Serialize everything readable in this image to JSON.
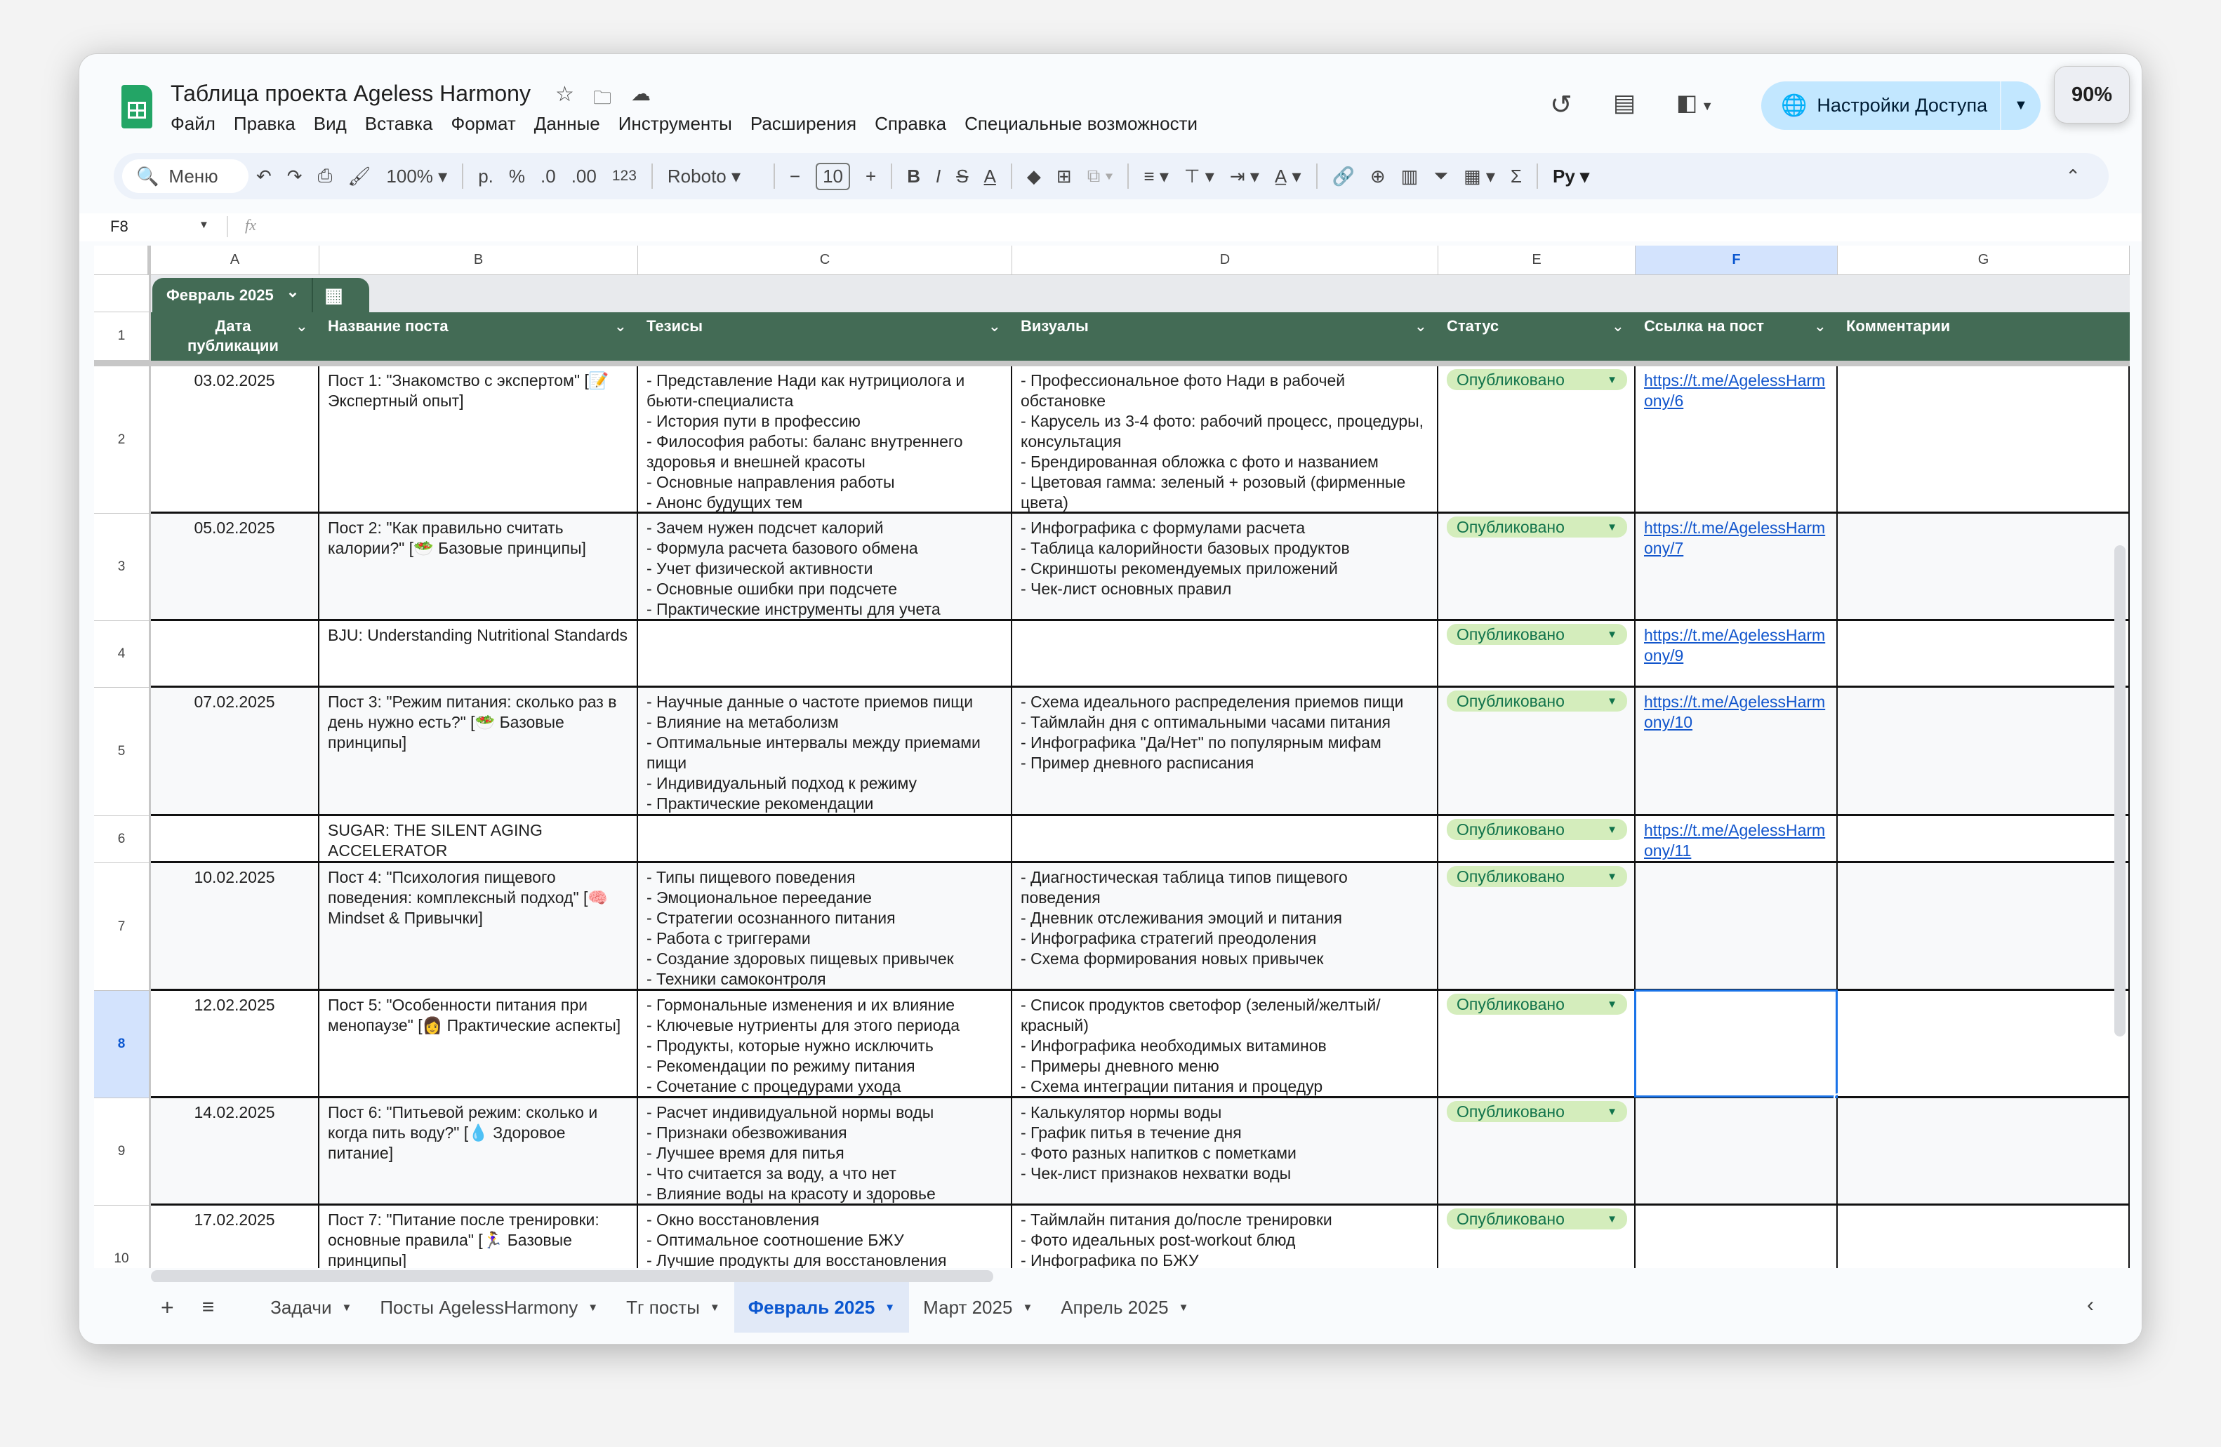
{
  "app": {
    "title": "Таблица проекта Ageless Harmony",
    "zoom": "90%",
    "share_label": "Настройки Доступа"
  },
  "menu": [
    "Файл",
    "Правка",
    "Вид",
    "Вставка",
    "Формат",
    "Данные",
    "Инструменты",
    "Расширения",
    "Справка",
    "Специальные возможности"
  ],
  "toolbar": {
    "search": "Меню",
    "zoom": "100%",
    "currency": "р.",
    "percent": "%",
    "dec_less": ".0",
    "dec_more": ".00",
    "number_format": "123",
    "font": "Roboto",
    "font_size": "10",
    "bold": "B",
    "italic": "I",
    "strike": "S",
    "text_color": "A",
    "python": "Pу"
  },
  "formula": {
    "cell_ref": "F8",
    "fx": "fx",
    "value": ""
  },
  "columns": [
    "A",
    "B",
    "C",
    "D",
    "E",
    "F",
    "G"
  ],
  "table": {
    "name": "Февраль 2025",
    "headers": [
      "Дата публикации",
      "Название поста",
      "Тезисы",
      "Визуалы",
      "Статус",
      "Ссылка на пост",
      "Комментарии"
    ]
  },
  "header_row_number": "1",
  "rows": [
    {
      "num": "2",
      "date": "03.02.2025",
      "title": "Пост 1: \"Знакомство с экспертом\" [📝 Экспертный опыт]",
      "theses": "- Представление Нади как нутрициолога и бьюти-специалиста\n- История пути в профессию\n- Философия работы: баланс внутреннего здоровья и внешней красоты\n- Основные направления работы\n- Анонс будущих тем",
      "visuals": "- Профессиональное фото Нади в рабочей обстановке\n- Карусель из 3-4 фото: рабочий процесс, процедуры, консультация\n- Брендированная обложка с фото и названием\n- Цветовая гамма: зеленый + розовый (фирменные цвета)",
      "status": "Опубликовано",
      "link": "https://t.me/AgelessHarmony/6",
      "comment": ""
    },
    {
      "num": "3",
      "date": "05.02.2025",
      "title": "Пост 2: \"Как правильно считать калории?\" [🥗 Базовые принципы]",
      "theses": "- Зачем нужен подсчет калорий\n- Формула расчета базового обмена\n- Учет физической активности\n- Основные ошибки при подсчете\n- Практические инструменты для учета",
      "visuals": "- Инфографика с формулами расчета\n- Таблица калорийности базовых продуктов\n- Скриншоты рекомендуемых приложений\n- Чек-лист основных правил",
      "status": "Опубликовано",
      "link": "https://t.me/AgelessHarmony/7",
      "comment": ""
    },
    {
      "num": "4",
      "date": "",
      "title": "BJU: Understanding Nutritional Standards",
      "theses": "",
      "visuals": "",
      "status": "Опубликовано",
      "link": "https://t.me/AgelessHarmony/9",
      "comment": ""
    },
    {
      "num": "5",
      "date": "07.02.2025",
      "title": "Пост 3: \"Режим питания: сколько раз в день нужно есть?\" [🥗 Базовые принципы]",
      "theses": "- Научные данные о частоте приемов пищи\n- Влияние на метаболизм\n- Оптимальные интервалы между приемами пищи\n- Индивидуальный подход к режиму\n- Практические рекомендации",
      "visuals": "- Схема идеального распределения приемов пищи\n- Таймлайн дня с оптимальными часами питания\n- Инфографика \"Да/Нет\" по популярным мифам\n- Пример дневного расписания",
      "status": "Опубликовано",
      "link": "https://t.me/AgelessHarmony/10",
      "comment": ""
    },
    {
      "num": "6",
      "date": "",
      "title": "SUGAR: THE SILENT AGING ACCELERATOR",
      "theses": "",
      "visuals": "",
      "status": "Опубликовано",
      "link": "https://t.me/AgelessHarmony/11",
      "comment": ""
    },
    {
      "num": "7",
      "date": "10.02.2025",
      "title": "Пост 4: \"Психология пищевого поведения: комплексный подход\" [🧠 Mindset & Привычки]",
      "theses": "- Типы пищевого поведения\n- Эмоциональное переедание\n- Стратегии осознанного питания\n- Работа с триггерами\n- Создание здоровых пищевых привычек\n- Техники самоконтроля",
      "visuals": "- Диагностическая таблица типов пищевого поведения\n- Дневник отслеживания эмоций и питания\n- Инфографика стратегий преодоления\n- Схема формирования новых привычек",
      "status": "Опубликовано",
      "link": "",
      "comment": ""
    },
    {
      "num": "8",
      "date": "12.02.2025",
      "title": "Пост 5: \"Особенности питания при менопаузе\" [👩 Практические аспекты]",
      "theses": "- Гормональные изменения и их влияние\n- Ключевые нутриенты для этого периода\n- Продукты, которые нужно исключить\n- Рекомендации по режиму питания\n- Сочетание с процедурами ухода",
      "visuals": "- Список продуктов светофор (зеленый/желтый/красный)\n- Инфографика необходимых витаминов\n- Примеры дневного меню\n- Схема интеграции питания и процедур",
      "status": "Опубликовано",
      "link": "",
      "comment": "",
      "selected": true
    },
    {
      "num": "9",
      "date": "14.02.2025",
      "title": "Пост 6: \"Питьевой режим: сколько и когда пить воду?\" [💧 Здоровое питание]",
      "theses": "- Расчет индивидуальной нормы воды\n- Признаки обезвоживания\n- Лучшее время для питья\n- Что считается за воду, а что нет\n- Влияние воды на красоту и здоровье",
      "visuals": "- Калькулятор нормы воды\n- График питья в течение дня\n- Фото разных напитков с пометками\n- Чек-лист признаков нехватки воды",
      "status": "Опубликовано",
      "link": "",
      "comment": ""
    },
    {
      "num": "10",
      "date": "17.02.2025",
      "title": "Пост 7: \"Питание после тренировки: основные правила\" [🏃‍♀️ Базовые принципы]",
      "theses": "- Окно восстановления\n- Оптимальное соотношение БЖУ\n- Лучшие продукты для восстановления",
      "visuals": "- Таймлайн питания до/после тренировки\n- Фото идеальных post-workout блюд\n- Инфографика по БЖУ",
      "status": "Опубликовано",
      "link": "",
      "comment": ""
    }
  ],
  "sheets": [
    {
      "label": "Задачи"
    },
    {
      "label": "Посты AgelessHarmony"
    },
    {
      "label": "Тг посты"
    },
    {
      "label": "Февраль 2025",
      "active": true
    },
    {
      "label": "Март 2025"
    },
    {
      "label": "Апрель 2025"
    }
  ],
  "colors": {
    "header_green": "#436b55",
    "chip_bg": "#d4edbc",
    "chip_text": "#11734b",
    "selection": "#1a73e8",
    "share_bg": "#c2e7ff"
  }
}
